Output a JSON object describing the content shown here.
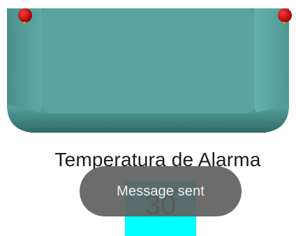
{
  "device_image": {
    "name": "alarm-device-illustration",
    "colors": {
      "body": "#5aa39f",
      "body_light": "#6bb8b3",
      "body_dark": "#3f7f7b",
      "screw": "#d40000"
    }
  },
  "alarm_screen": {
    "title": "Temperatura de Alarma",
    "value": "30",
    "value_box_color": "#00ffff"
  },
  "toast": {
    "message": "Message sent"
  }
}
